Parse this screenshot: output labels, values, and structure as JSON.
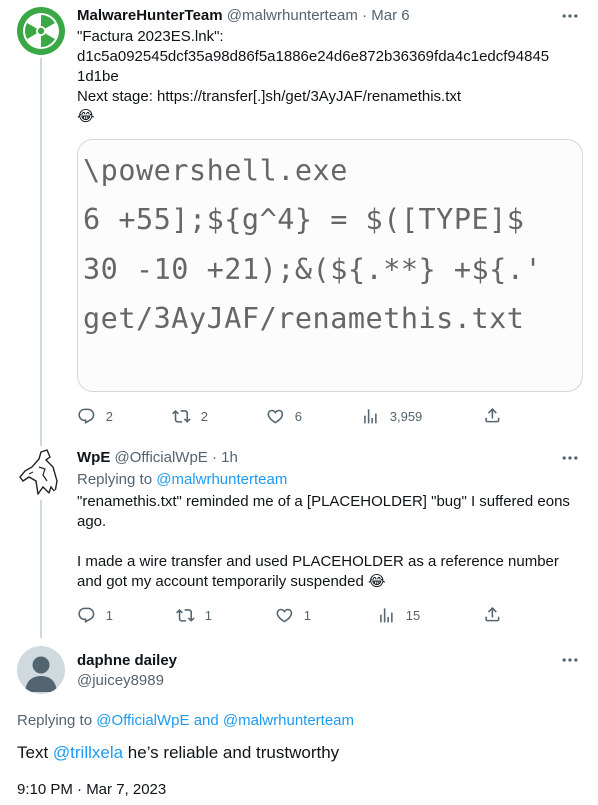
{
  "tweet1": {
    "author_name": "MalwareHunterTeam",
    "author_handle": "@malwrhunterteam",
    "separator": "·",
    "date": "Mar 6",
    "text_line1": "\"Factura 2023ES.lnk\":",
    "text_line2": "d1c5a092545dcf35a98d86f5a1886e24d6e872b36369fda4c1edcf94845",
    "text_line3": "1d1be",
    "text_line4": "Next stage: https://transfer[.]sh/get/3AyJAF/renamethis.txt",
    "emoji": "😂",
    "media_lines": [
      "\\powershell.exe",
      "6 +55];${g^4} = $([TYPE]$",
      "30 -10 +21);&(${.**} +${.'",
      "get/3AyJAF/renamethis.txt"
    ],
    "replies": "2",
    "retweets": "2",
    "likes": "6",
    "views": "3,959"
  },
  "tweet2": {
    "author_name": "WpE",
    "author_handle": "@OfficialWpE",
    "separator": "·",
    "time": "1h",
    "replying_prefix": "Replying to ",
    "replying_handle": "@malwrhunterteam",
    "text_line1": "\"renamethis.txt\" reminded me of a [PLACEHOLDER]  \"bug\" I suffered eons",
    "text_line2": "ago.",
    "text_line3": "I made a wire transfer and used PLACEHOLDER as a reference number",
    "text_line4": "and got my account temporarily suspended",
    "emoji": "😂",
    "replies": "1",
    "retweets": "1",
    "likes": "1",
    "views": "15"
  },
  "tweet3": {
    "author_name": "daphne dailey",
    "author_handle": "@juicey8989",
    "replying_prefix": "Replying to ",
    "replying_handle1": "@OfficialWpE",
    "replying_and": " and ",
    "replying_handle2": "@malwrhunterteam",
    "text_prefix": "Text ",
    "text_mention": "@trillxela",
    "text_suffix": " he’s reliable and trustworthy",
    "timestamp": "9:10 PM · Mar 7, 2023"
  },
  "colors": {
    "accent": "#1d9bf0",
    "muted": "#536471",
    "avatar_green": "#3aa845",
    "line": "#cfd9de"
  }
}
